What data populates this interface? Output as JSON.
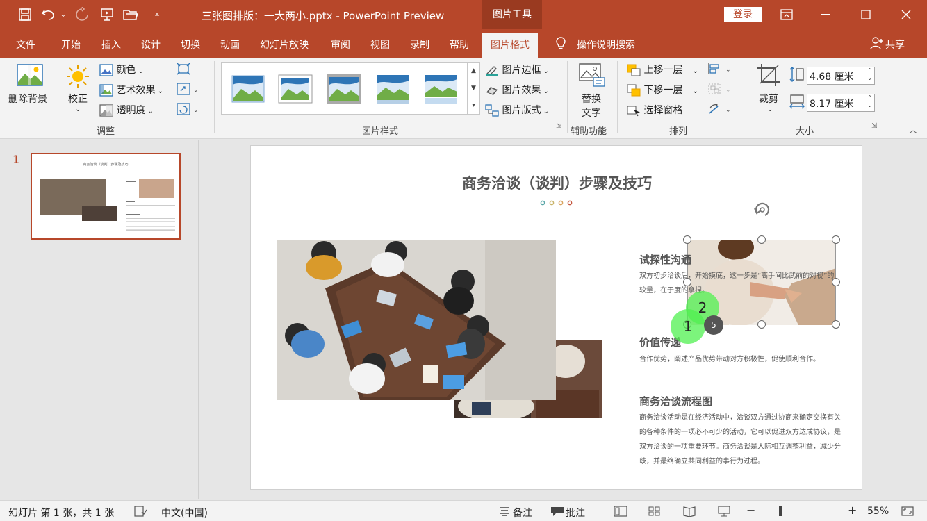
{
  "titlebar": {
    "title": "三张图排版：一大两小.pptx  -  PowerPoint Preview",
    "context_group": "图片工具",
    "login": "登录"
  },
  "tabs": [
    "文件",
    "开始",
    "插入",
    "设计",
    "切换",
    "动画",
    "幻灯片放映",
    "审阅",
    "视图",
    "录制",
    "帮助",
    "图片格式"
  ],
  "tell_me": "操作说明搜索",
  "share": "共享",
  "ribbon": {
    "adjust": {
      "remove_bg": "删除背景",
      "corrections": "校正",
      "color": "颜色",
      "artistic": "艺术效果",
      "transparency": "透明度",
      "label": "调整"
    },
    "styles": {
      "border": "图片边框",
      "effects": "图片效果",
      "layout": "图片版式",
      "label": "图片样式"
    },
    "accessibility": {
      "alt_text_line1": "替换",
      "alt_text_line2": "文字",
      "label": "辅助功能"
    },
    "arrange": {
      "bring_forward": "上移一层",
      "send_backward": "下移一层",
      "selection_pane": "选择窗格",
      "label": "排列"
    },
    "size": {
      "crop": "裁剪",
      "height": "4.68 厘米",
      "width": "8.17 厘米",
      "label": "大小"
    }
  },
  "thumbnail": {
    "number": "1"
  },
  "slide": {
    "title": "商务洽谈（谈判）步骤及技巧",
    "dot_colors": [
      "#5aa6a8",
      "#c9b46a",
      "#d9a35e",
      "#c4573f"
    ],
    "sections": [
      {
        "heading": "试探性沟通",
        "body": "双方初步洽谈后，开始摸底，这一步是“高手间比武前的对视”的较量，在于度的拿捏。"
      },
      {
        "heading": "价值传递",
        "body": "合作优势，阐述产品优势带动对方积极性，促使顺利合作。"
      },
      {
        "heading": "商务洽谈流程图",
        "body": "商务洽谈活动是在经济活动中，洽谈双方通过协商来确定交换有关的各种条件的一项必不可少的活动，它可以促进双方达成协议，是双方洽谈的一项重要环节。商务洽谈是人际相互调整利益，减少分歧，并最终确立共同利益的事行为过程。"
      }
    ],
    "markers": [
      "1",
      "2",
      "5"
    ]
  },
  "status": {
    "slide_info": "幻灯片 第 1 张，共 1 张",
    "language": "中文(中国)",
    "notes": "备注",
    "comments": "批注",
    "zoom": "55%"
  }
}
